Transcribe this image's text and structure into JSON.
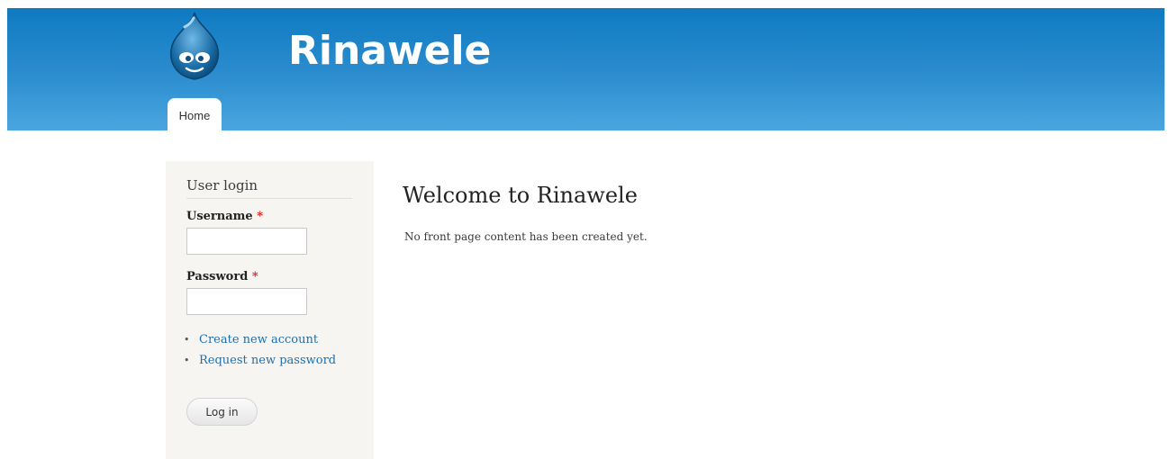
{
  "header": {
    "site_name": "Rinawele",
    "logo_icon": "drupal-drop-logo",
    "nav_tabs": [
      {
        "label": "Home",
        "active": true
      }
    ],
    "colors": {
      "header_top": "#0f7ac1",
      "header_bottom": "#4aa6df"
    }
  },
  "sidebar": {
    "block_title": "User login",
    "username_label": "Username",
    "password_label": "Password",
    "required_marker": "*",
    "username_value": "",
    "password_value": "",
    "links": [
      {
        "label": "Create new account"
      },
      {
        "label": "Request new password"
      }
    ],
    "login_button_label": "Log in",
    "link_color": "#1e6fae",
    "required_color": "#e0241b"
  },
  "main": {
    "title": "Welcome to Rinawele",
    "message": "No front page content has been created yet."
  }
}
